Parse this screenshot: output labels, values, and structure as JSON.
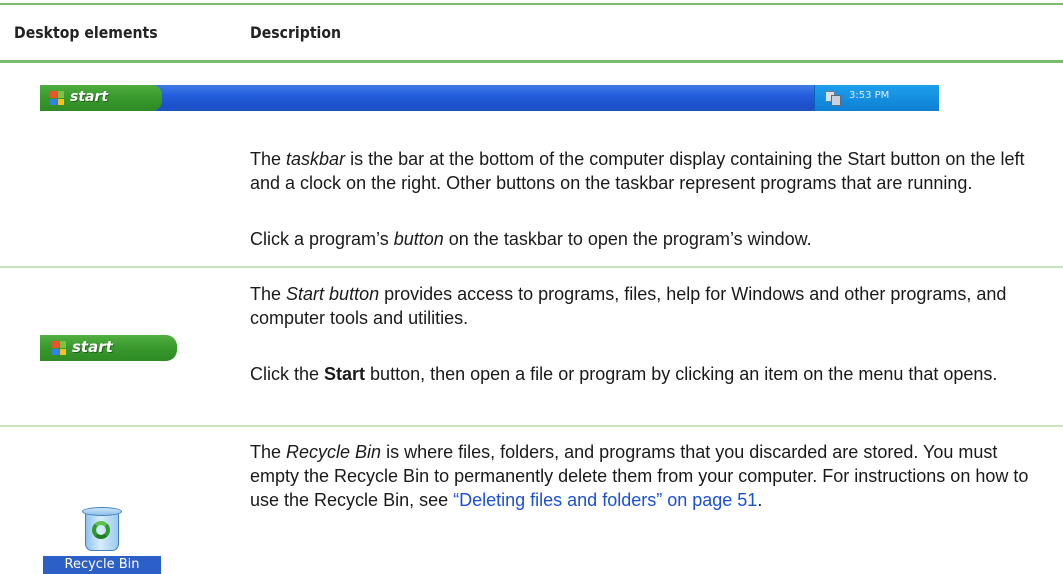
{
  "header": {
    "col1": "Desktop elements",
    "col2": "Description"
  },
  "taskbar_row": {
    "image": {
      "start_label": "start",
      "clock": "3:53 PM",
      "colors": {
        "bar": "#245ddb",
        "start": "#3a9a2e",
        "tray": "#158fe1"
      }
    },
    "p1": {
      "a": "The ",
      "term": "taskbar",
      "b": " is the bar at the bottom of the computer display containing the Start button on the left and a clock on the right. Other buttons on the taskbar represent programs that are running."
    },
    "p2": {
      "a": "Click a program’s ",
      "term": "button",
      "b": " on the taskbar to open the program’s window."
    }
  },
  "start_row": {
    "image": {
      "label": "start"
    },
    "p1": {
      "a": "The ",
      "term": "Start button",
      "b": " provides access to programs, files, help for Windows and other programs, and computer tools and utilities."
    },
    "p2": {
      "a": "Click the ",
      "strong": "Start",
      "b": " button, then open a file or program by clicking an item on the menu that opens."
    }
  },
  "recycle_row": {
    "image": {
      "label": "Recycle Bin",
      "icon": "recycle-bin-icon"
    },
    "p1": {
      "a": "The ",
      "term": "Recycle Bin",
      "b": " is where files, folders, and programs that you discarded are stored. You must empty the Recycle Bin to permanently delete them from your computer. For instructions on how to use the Recycle Bin, see ",
      "link": "“Deleting files and folders” on page 51",
      "c": "."
    }
  },
  "colors": {
    "rule": "#7dbb6c",
    "rule_light": "#c6e3bd",
    "link": "#1a4fd6"
  }
}
